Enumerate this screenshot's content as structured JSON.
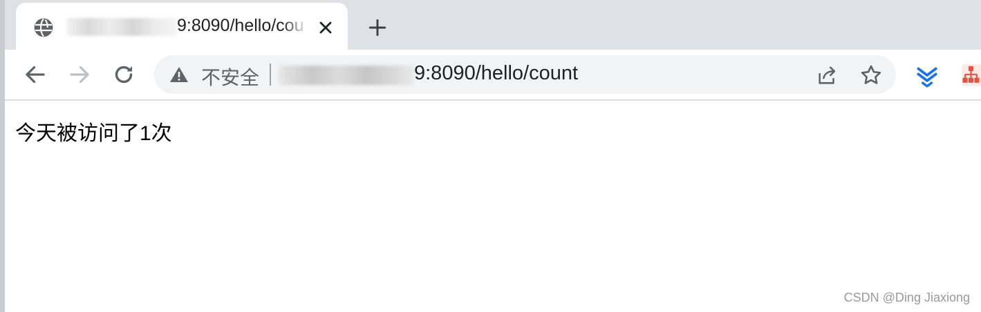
{
  "tab": {
    "title": "9:8090/hello/cou",
    "favicon_icon": "globe-icon",
    "close_icon": "close-icon"
  },
  "toolbar": {
    "back_icon": "back-arrow-icon",
    "forward_icon": "forward-arrow-icon",
    "reload_icon": "reload-icon",
    "new_tab_icon": "plus-icon"
  },
  "omnibox": {
    "security_icon": "warning-triangle-icon",
    "security_label": "不安全",
    "url_visible": "9:8090/hello/count",
    "share_icon": "share-icon",
    "bookmark_icon": "star-icon"
  },
  "extensions": [
    {
      "icon": "chevron-layers-icon",
      "color": "#1a73e8"
    },
    {
      "icon": "sitemap-icon",
      "color": "#e8533c"
    }
  ],
  "page": {
    "message": "今天被访问了1次"
  },
  "watermark": "CSDN @Ding Jiaxiong",
  "colors": {
    "tabstrip": "#dee1e6",
    "omnibox": "#f1f3f4",
    "icon_gray": "#5f6368"
  }
}
